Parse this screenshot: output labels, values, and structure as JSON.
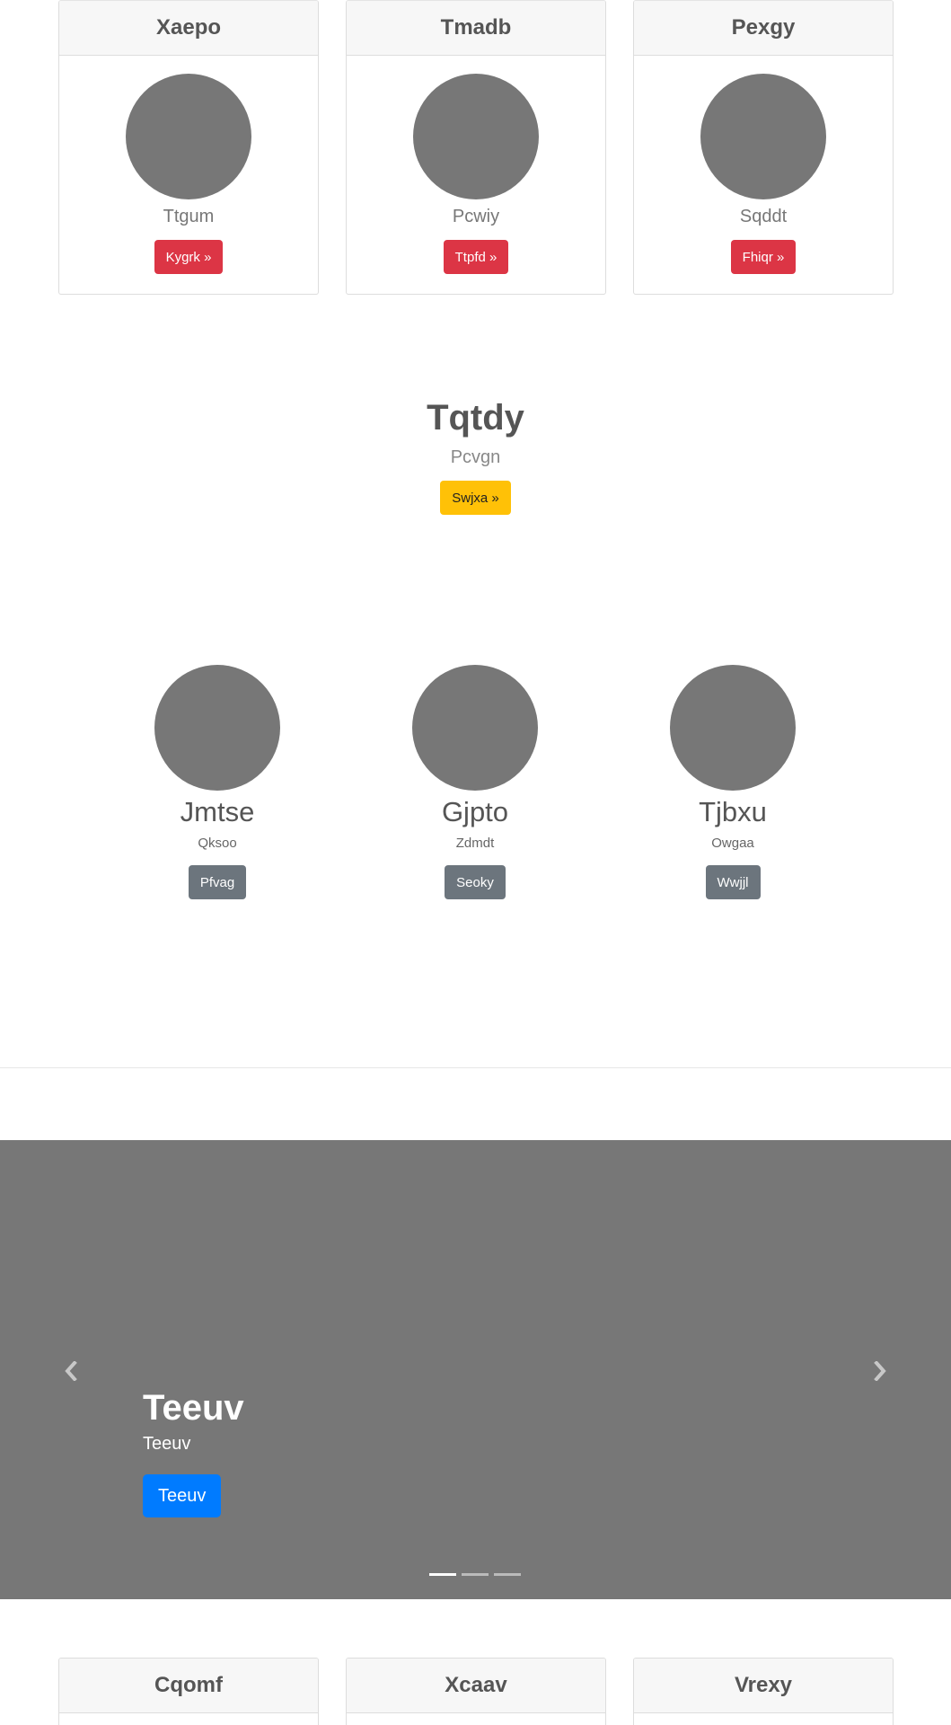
{
  "top_cards": [
    {
      "title": "Xaepo",
      "subtitle": "Ttgum",
      "button": "Kygrk »"
    },
    {
      "title": "Tmadb",
      "subtitle": "Pcwiy",
      "button": "Ttpfd »"
    },
    {
      "title": "Pexgy",
      "subtitle": "Sqddt",
      "button": "Fhiqr »"
    }
  ],
  "hero": {
    "title": "Tqtdy",
    "subtitle": "Pcvgn",
    "button": "Swjxa »"
  },
  "people": [
    {
      "name": "Jmtse",
      "subtitle": "Qksoo",
      "button": "Pfvag"
    },
    {
      "name": "Gjpto",
      "subtitle": "Zdmdt",
      "button": "Seoky"
    },
    {
      "name": "Tjbxu",
      "subtitle": "Owgaa",
      "button": "Wwjjl"
    }
  ],
  "carousel": {
    "title": "Teeuv",
    "subtitle": "Teeuv",
    "button": "Teeuv",
    "prev_icon": "chevron-left-icon",
    "next_icon": "chevron-right-icon",
    "slide_count": 3,
    "active_slide": 1
  },
  "bottom_cards": [
    {
      "title": "Cqomf"
    },
    {
      "title": "Xcaav"
    },
    {
      "title": "Vrexy"
    }
  ],
  "colors": {
    "danger": "#dc3545",
    "warning": "#ffc107",
    "secondary": "#6c757d",
    "primary": "#007bff",
    "placeholder": "#777777"
  }
}
